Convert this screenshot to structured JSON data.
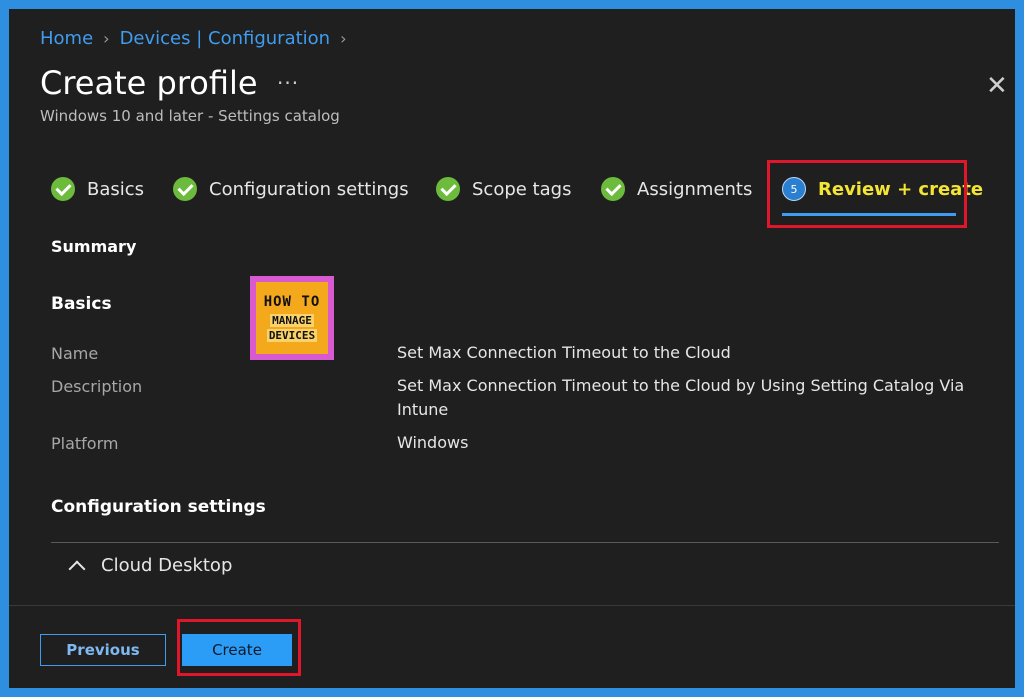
{
  "breadcrumb": {
    "items": [
      "Home",
      "Devices | Configuration"
    ]
  },
  "header": {
    "title": "Create profile",
    "more_label": "···",
    "subtitle": "Windows 10 and later - Settings catalog",
    "close_label": "✕"
  },
  "steps": [
    {
      "label": "Basics",
      "state": "complete"
    },
    {
      "label": "Configuration settings",
      "state": "complete"
    },
    {
      "label": "Scope tags",
      "state": "complete"
    },
    {
      "label": "Assignments",
      "state": "complete"
    },
    {
      "label": "Review + create",
      "state": "active",
      "number": "5"
    }
  ],
  "summary": {
    "heading": "Summary",
    "basics_heading": "Basics",
    "fields": [
      {
        "label": "Name",
        "value": "Set Max Connection Timeout to the Cloud"
      },
      {
        "label": "Description",
        "value": "Set Max Connection Timeout to the Cloud by Using Setting Catalog Via Intune"
      },
      {
        "label": "Platform",
        "value": "Windows"
      }
    ],
    "config_heading": "Configuration settings",
    "accordion_label": "Cloud Desktop"
  },
  "logo": {
    "line1": "HOW TO",
    "line2": "MANAGE",
    "line3": "DEVICES"
  },
  "footer": {
    "previous_label": "Previous",
    "create_label": "Create"
  },
  "colors": {
    "accent": "#3f9cf0",
    "highlight": "#e0162b",
    "check": "#6cbb3c",
    "active_step_text": "#f2e533"
  }
}
